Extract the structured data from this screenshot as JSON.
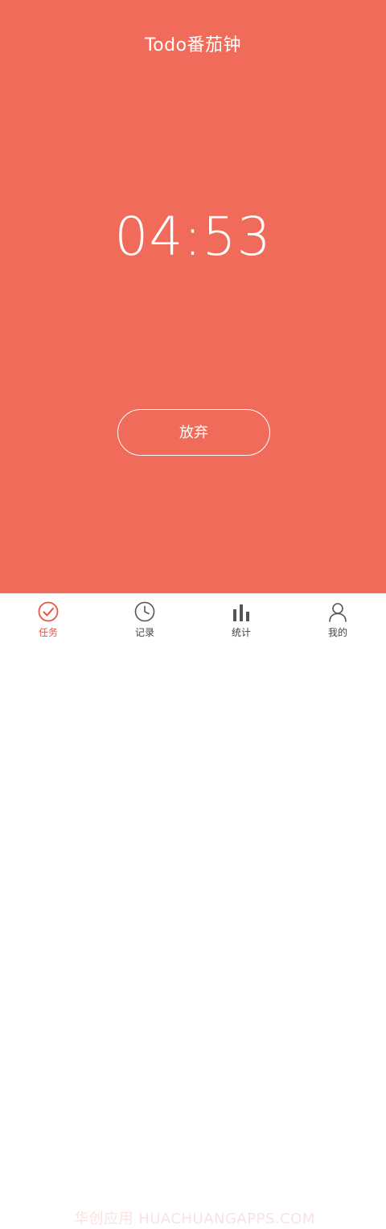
{
  "header": {
    "title": "Todo番茄钟"
  },
  "timer": {
    "remaining": "04:53"
  },
  "actions": {
    "give_up_label": "放弃"
  },
  "tabbar": {
    "tabs": [
      {
        "label": "任务",
        "icon": "check-circle-icon",
        "active": true
      },
      {
        "label": "记录",
        "icon": "clock-icon",
        "active": false
      },
      {
        "label": "统计",
        "icon": "bar-chart-icon",
        "active": false
      },
      {
        "label": "我的",
        "icon": "user-icon",
        "active": false
      }
    ]
  },
  "watermark": {
    "text": "华创应用 HUACHUANGAPPS.COM"
  },
  "colors": {
    "background": "#F06B59",
    "accent": "#E8553F",
    "tab_inactive": "#555555"
  }
}
